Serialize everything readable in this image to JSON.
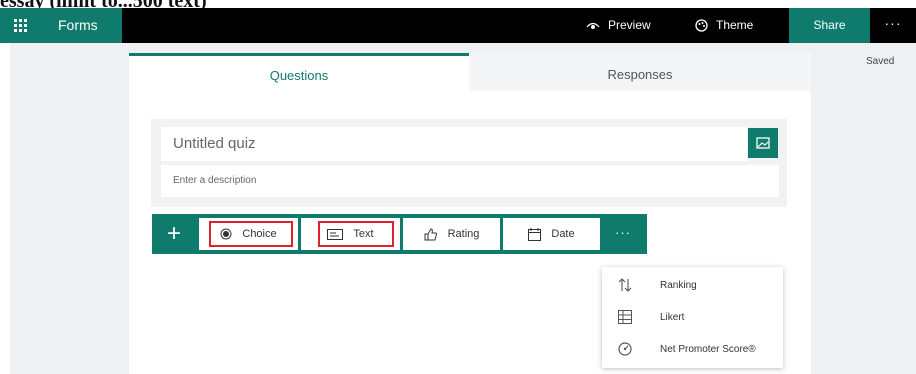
{
  "caption": "essay (limit to...500 text)",
  "topbar": {
    "app_name": "Forms",
    "preview_label": "Preview",
    "theme_label": "Theme",
    "share_label": "Share",
    "more_label": "···"
  },
  "status": {
    "saved": "Saved"
  },
  "tabs": [
    {
      "label": "Questions",
      "active": true
    },
    {
      "label": "Responses",
      "active": false
    }
  ],
  "form": {
    "title_placeholder": "Untitled quiz",
    "description_placeholder": "Enter a description"
  },
  "toolbar": {
    "add_label": "+",
    "items": [
      {
        "label": "Choice",
        "icon": "radio-icon",
        "highlighted": true
      },
      {
        "label": "Text",
        "icon": "text-icon",
        "highlighted": true
      },
      {
        "label": "Rating",
        "icon": "thumbs-up-icon",
        "highlighted": false
      },
      {
        "label": "Date",
        "icon": "calendar-icon",
        "highlighted": false
      }
    ],
    "more_label": "···"
  },
  "more_menu": {
    "items": [
      {
        "label": "Ranking",
        "icon": "sort-arrows-icon"
      },
      {
        "label": "Likert",
        "icon": "grid-icon"
      },
      {
        "label": "Net Promoter Score®",
        "icon": "gauge-icon"
      }
    ]
  },
  "colors": {
    "brand": "#0f7b6c",
    "highlight": "#e0212d",
    "topbar": "#000000",
    "page_bg": "#eef0f2"
  }
}
